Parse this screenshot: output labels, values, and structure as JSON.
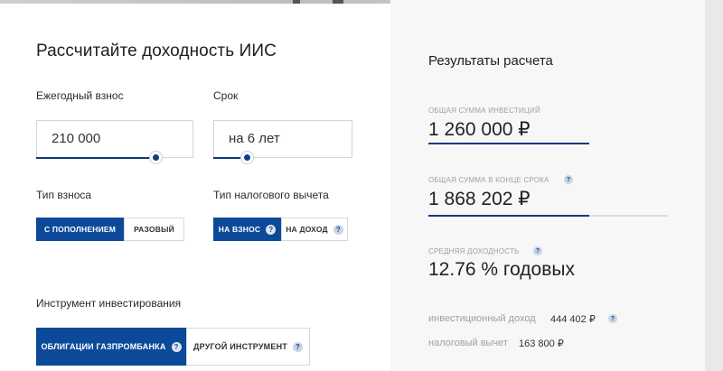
{
  "calculator": {
    "title": "Рассчитайте доходность ИИС",
    "annual_contribution": {
      "label": "Ежегодный взнос",
      "value": "210 000",
      "slider_fraction": 0.76
    },
    "term": {
      "label": "Срок",
      "value": "на 6 лет",
      "slider_fraction": 0.24
    },
    "contribution_type": {
      "label": "Тип взноса",
      "options": [
        "С пополнением",
        "Разовый"
      ],
      "selected": "С пополнением"
    },
    "tax_deduction_type": {
      "label": "Тип налогового вычета",
      "options": [
        "На взнос",
        "На доход"
      ],
      "selected": "На взнос",
      "help": "?"
    },
    "instrument": {
      "label": "Инструмент инвестирования",
      "options": [
        "Облигации Газпромбанка",
        "Другой инструмент"
      ],
      "selected": "Облигации Газпромбанка",
      "help": "?"
    }
  },
  "results": {
    "title": "Результаты расчета",
    "total_investment": {
      "caption": "Общая сумма инвестиций",
      "value": "1 260 000 ₽",
      "bar_fraction": 0.67
    },
    "total_end": {
      "caption": "Общая сумма в конце срока",
      "value": "1 868 202 ₽",
      "bar_fraction": 0.67,
      "help": "?"
    },
    "avg_yield": {
      "caption": "Средняя доходность",
      "value": "12.76 % годовых",
      "help": "?"
    },
    "investment_income": {
      "label": "инвестиционный доход",
      "value": "444 402 ₽",
      "help": "?"
    },
    "tax_deduction": {
      "label": "налоговый вычет",
      "value": "163 800 ₽"
    }
  },
  "colors": {
    "accent": "#0c4a99",
    "slider": "#0d3a7a",
    "caption": "#9aa0a8"
  }
}
